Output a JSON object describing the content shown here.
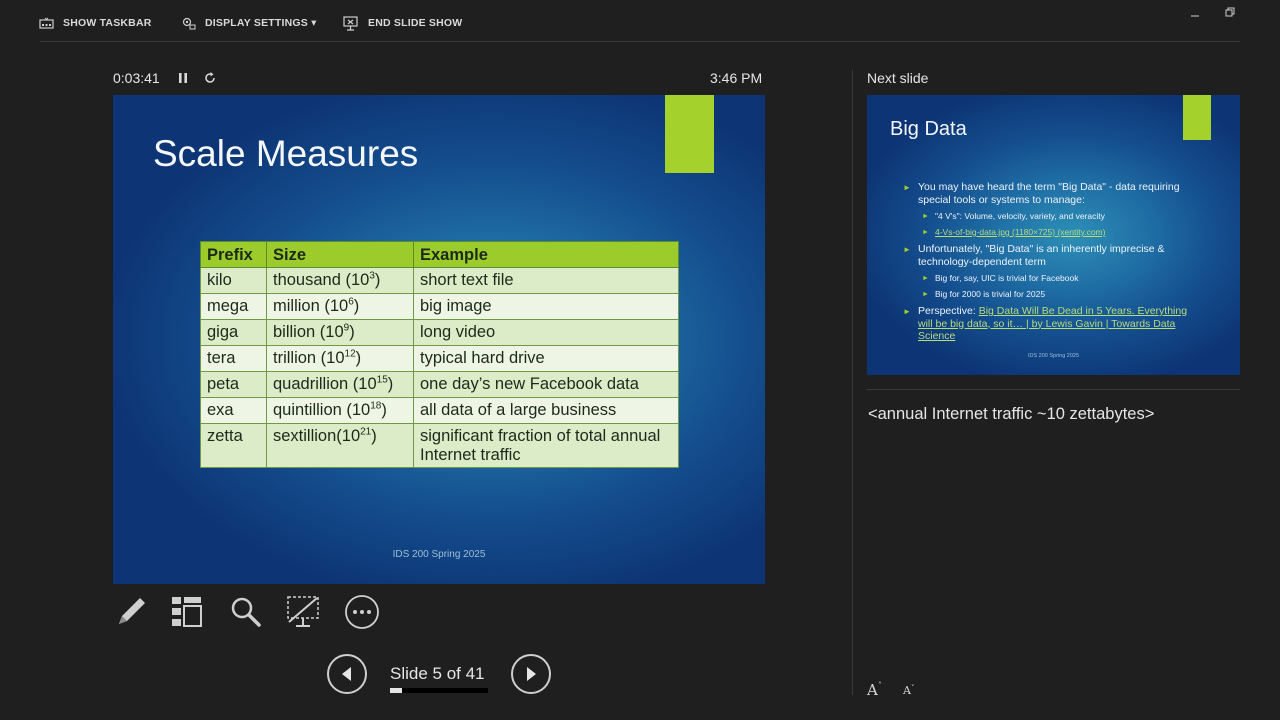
{
  "toolbar": {
    "show_taskbar": "SHOW TASKBAR",
    "display_settings": "DISPLAY SETTINGS ▾",
    "end_slide_show": "END SLIDE SHOW"
  },
  "presenter": {
    "timer": "0:03:41",
    "clock": "3:46 PM"
  },
  "current_slide": {
    "title": "Scale Measures",
    "footer": "IDS 200 Spring 2025",
    "table": {
      "headers": [
        "Prefix",
        "Size",
        "Example"
      ],
      "rows": [
        {
          "prefix": "kilo",
          "size": "thousand (10",
          "exp": "3",
          "close": ")",
          "example": "short text file"
        },
        {
          "prefix": "mega",
          "size": "million (10",
          "exp": "6",
          "close": ")",
          "example": "big image"
        },
        {
          "prefix": "giga",
          "size": "billion (10",
          "exp": "9",
          "close": ")",
          "example": "long video"
        },
        {
          "prefix": "tera",
          "size": "trillion (10",
          "exp": "12",
          "close": ")",
          "example": "typical hard drive"
        },
        {
          "prefix": "peta",
          "size": "quadrillion (10",
          "exp": "15",
          "close": ")",
          "example": "one day’s new Facebook data"
        },
        {
          "prefix": "exa",
          "size": "quintillion (10",
          "exp": "18",
          "close": ")",
          "example": "all data of a large business"
        },
        {
          "prefix": "zetta",
          "size": "sextillion(10",
          "exp": "21",
          "close": ")",
          "example": "significant fraction of total annual Internet traffic"
        }
      ]
    }
  },
  "navigation": {
    "slide_counter": "Slide 5 of 41",
    "progress_fraction": 0.122
  },
  "next_slide": {
    "label": "Next slide",
    "title": "Big Data",
    "bullets": [
      {
        "level": 1,
        "text": "You may have heard the term \"Big Data\" - data requiring special tools or systems to manage:"
      },
      {
        "level": 2,
        "text": "\"4 V's\": Volume, velocity, variety, and veracity"
      },
      {
        "level": 2,
        "text": "4-Vs-of-big-data.jpg (1180×725) (xentity.com)",
        "link": true
      },
      {
        "level": 1,
        "text": "Unfortunately, \"Big Data\" is an inherently imprecise & technology-dependent term"
      },
      {
        "level": 2,
        "text": "Big for, say, UIC is trivial for Facebook"
      },
      {
        "level": 2,
        "text": "Big for 2000 is trivial for 2025"
      },
      {
        "level": 1,
        "prefix": "Perspective: ",
        "text": "Big Data Will Be Dead in 5 Years. Everything will be big data, so it… | by Lewis Gavin | Towards Data Science",
        "link": true
      }
    ],
    "footer": "IDS 200 Spring 2025"
  },
  "notes": {
    "text": "<annual Internet traffic ~10 zettabytes>"
  },
  "colors": {
    "background": "#1f1f1f",
    "accent_green": "#a5d12d",
    "table_header": "#9ccb2c",
    "slide_blue": "#1f6ea5"
  },
  "icons": {
    "taskbar": "taskbar-icon",
    "display": "display-settings-icon",
    "end": "end-show-icon",
    "pen": "pen-icon",
    "grid": "see-all-slides-icon",
    "zoom": "magnifier-icon",
    "screen": "black-screen-icon",
    "more": "more-options-icon",
    "prev": "previous-arrow-icon",
    "next": "next-arrow-icon"
  }
}
